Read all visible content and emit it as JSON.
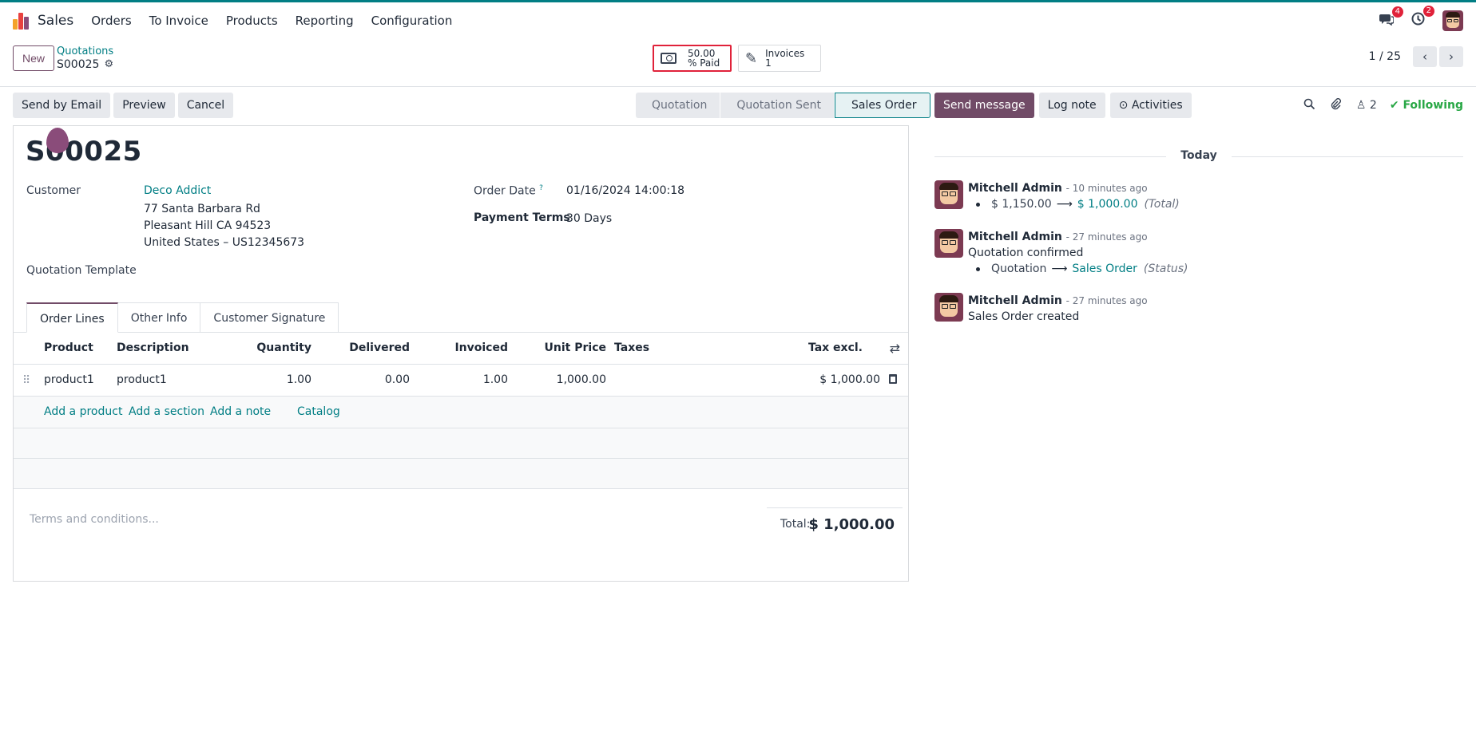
{
  "navbar": {
    "app_name": "Sales",
    "menu": [
      "Orders",
      "To Invoice",
      "Products",
      "Reporting",
      "Configuration"
    ],
    "messages_badge": "4",
    "activities_badge": "2"
  },
  "control": {
    "new_label": "New",
    "breadcrumb_parent": "Quotations",
    "breadcrumb_current": "S00025",
    "paid_value": "50.00",
    "paid_label": "% Paid",
    "invoices_label": "Invoices",
    "invoices_count": "1",
    "pager": "1 / 25"
  },
  "actions": {
    "send_email": "Send by Email",
    "preview": "Preview",
    "cancel": "Cancel"
  },
  "statusbar": {
    "stages": [
      "Quotation",
      "Quotation Sent",
      "Sales Order"
    ],
    "active": "Sales Order"
  },
  "form": {
    "title": "S00025",
    "customer_label": "Customer",
    "customer_name": "Deco Addict",
    "address_line1": "77 Santa Barbara Rd",
    "address_line2": "Pleasant Hill CA 94523",
    "address_line3": "United States – US12345673",
    "order_date_label": "Order Date",
    "order_date_help": "?",
    "order_date": "01/16/2024 14:00:18",
    "payment_terms_label": "Payment Terms",
    "payment_terms": "30 Days",
    "quotation_template_label": "Quotation Template"
  },
  "tabs": [
    "Order Lines",
    "Other Info",
    "Customer Signature"
  ],
  "lines": {
    "columns": [
      "Product",
      "Description",
      "Quantity",
      "Delivered",
      "Invoiced",
      "Unit Price",
      "Taxes",
      "Tax excl."
    ],
    "rows": [
      {
        "product": "product1",
        "description": "product1",
        "quantity": "1.00",
        "delivered": "0.00",
        "invoiced": "1.00",
        "unit_price": "1,000.00",
        "taxes": "",
        "subtotal": "$ 1,000.00"
      }
    ],
    "add_product": "Add a product",
    "add_section": "Add a section",
    "add_note": "Add a note",
    "catalog": "Catalog"
  },
  "footer": {
    "terms_placeholder": "Terms and conditions...",
    "total_label": "Total:",
    "total_value": "$ 1,000.00"
  },
  "chatter": {
    "send_message": "Send message",
    "log_note": "Log note",
    "activities": "Activities",
    "followers_count": "2",
    "following": "Following",
    "today": "Today",
    "messages": [
      {
        "author": "Mitchell Admin",
        "time": "- 10 minutes ago",
        "old_value": "$ 1,150.00",
        "new_value": "$ 1,000.00",
        "field": "(Total)"
      },
      {
        "author": "Mitchell Admin",
        "time": "- 27 minutes ago",
        "text": "Quotation confirmed",
        "old_value": "Quotation",
        "new_value": "Sales Order",
        "field": "(Status)"
      },
      {
        "author": "Mitchell Admin",
        "time": "- 27 minutes ago",
        "text": "Sales Order created"
      }
    ]
  },
  "colors": {
    "brand": "#714b67",
    "link": "#017e84",
    "badge": "#e0223a",
    "following": "#28a745"
  }
}
